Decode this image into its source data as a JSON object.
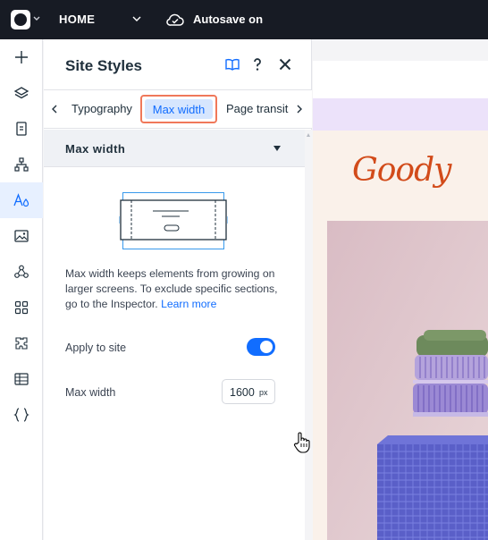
{
  "topbar": {
    "page_name": "HOME",
    "autosave_text": "Autosave on"
  },
  "rail": {
    "items": [
      "add",
      "layers",
      "pages",
      "sitemap",
      "site-styles",
      "media",
      "apps-network",
      "apps",
      "add-ons",
      "table",
      "code"
    ],
    "active_item": "site-styles"
  },
  "panel": {
    "title": "Site Styles",
    "tabs": [
      {
        "label": "Typography",
        "active": false
      },
      {
        "label": "Max width",
        "active": true
      },
      {
        "label": "Page transiti",
        "active": false
      }
    ],
    "section_title": "Max width",
    "description": "Max width keeps elements from growing on larger screens. To exclude specific sections, go to the Inspector.",
    "description_link": "Learn more",
    "apply_label": "Apply to site",
    "apply_on": true,
    "max_width_label": "Max width",
    "max_width_value": "1600",
    "max_width_unit": "px"
  },
  "preview": {
    "brand": "Goody"
  },
  "colors": {
    "accent": "#116dff",
    "tab_highlight": "#f0785a",
    "brand": "#d24b1a",
    "topbar": "#171b24"
  }
}
